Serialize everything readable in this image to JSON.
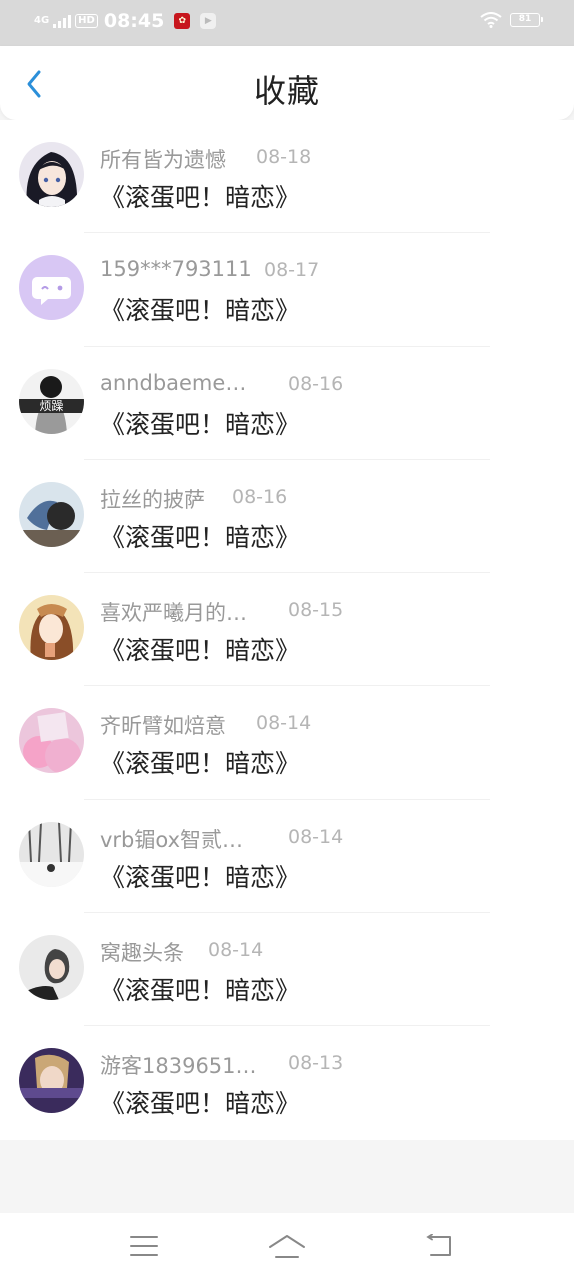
{
  "status_bar": {
    "network": "4G",
    "hd": "HD",
    "time": "08:45",
    "battery": "81"
  },
  "header": {
    "title": "收藏",
    "back_icon": "chevron-left-icon"
  },
  "favorites": [
    {
      "name": "所有皆为遗憾",
      "date": "08-18",
      "title": "《滚蛋吧！暗恋》"
    },
    {
      "name": "159***793111",
      "date": "08-17",
      "title": "《滚蛋吧！暗恋》"
    },
    {
      "name": "anndbaeme…",
      "date": "08-16",
      "title": "《滚蛋吧！暗恋》",
      "avatar_text": "烦躁"
    },
    {
      "name": "拉丝的披萨",
      "date": "08-16",
      "title": "《滚蛋吧！暗恋》"
    },
    {
      "name": "喜欢严曦月的…",
      "date": "08-15",
      "title": "《滚蛋吧！暗恋》"
    },
    {
      "name": "齐昕臂如焙意",
      "date": "08-14",
      "title": "《滚蛋吧！暗恋》"
    },
    {
      "name": "vrb镅ox智贰…",
      "date": "08-14",
      "title": "《滚蛋吧！暗恋》"
    },
    {
      "name": "窝趣头条",
      "date": "08-14",
      "title": "《滚蛋吧！暗恋》"
    },
    {
      "name": "游客1839651…",
      "date": "08-13",
      "title": "《滚蛋吧！暗恋》"
    }
  ],
  "nav_bar": {
    "menu_icon": "menu-icon",
    "home_icon": "home-icon",
    "back_icon": "back-icon"
  },
  "colors": {
    "accent": "#2b8fd9",
    "name_text": "#999999",
    "title_text": "#222222",
    "status_bar_bg": "#d9d9d9"
  }
}
